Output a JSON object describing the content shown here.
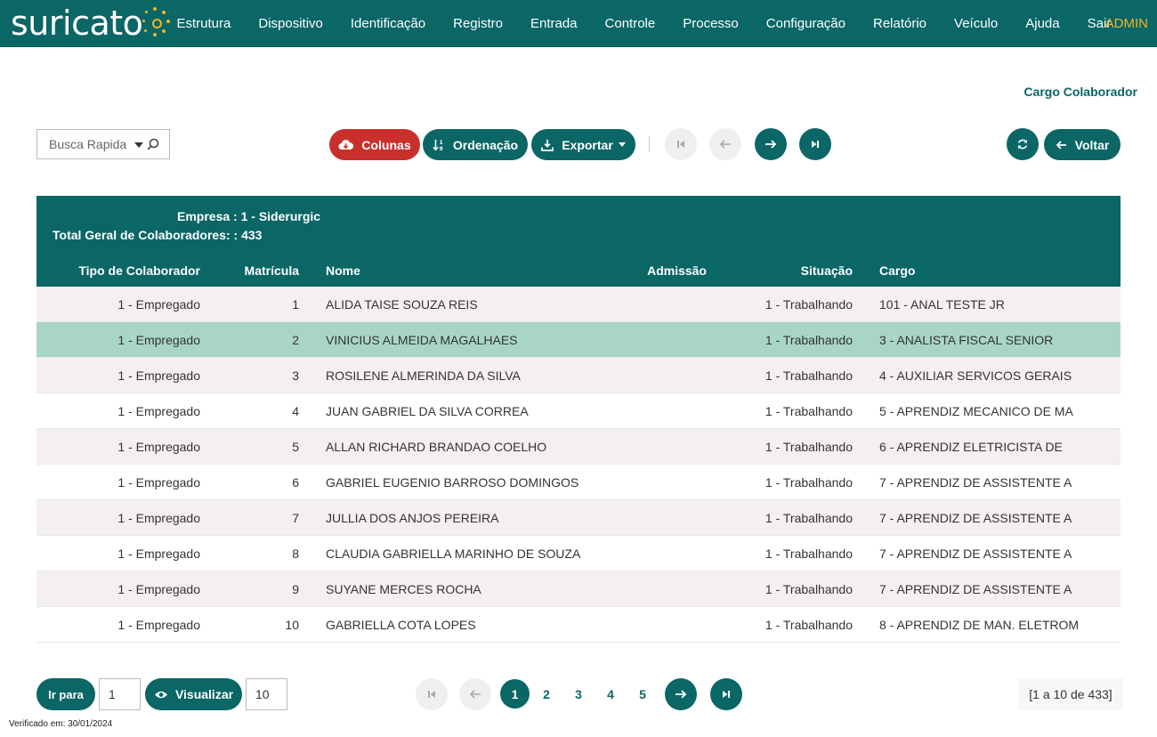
{
  "brand": {
    "logo_text": "suricato",
    "accent": "#f0b429",
    "primary": "#0b6666",
    "danger": "#c9302c"
  },
  "menu": {
    "items": [
      "Estrutura",
      "Dispositivo",
      "Identificação",
      "Registro",
      "Entrada",
      "Controle",
      "Processo",
      "Configuração",
      "Relatório",
      "Veículo",
      "Ajuda",
      "Sair"
    ],
    "user": "ADMIN"
  },
  "page": {
    "title": "Cargo Colaborador"
  },
  "search": {
    "placeholder": "Busca Rapida"
  },
  "toolbar": {
    "columns_label": "Colunas",
    "sort_label": "Ordenação",
    "export_label": "Exportar",
    "back_label": "Voltar"
  },
  "report": {
    "company_line": "Empresa : 1 - Siderurgic",
    "total_line": "Total Geral de Colaboradores: : 433"
  },
  "table": {
    "columns": [
      "Tipo de Colaborador",
      "Matrícula",
      "Nome",
      "Admissão",
      "Situação",
      "Cargo"
    ],
    "rows": [
      {
        "tipo": "1 - Empregado",
        "matricula": "1",
        "nome": "ALIDA TAISE SOUZA REIS",
        "admissao": "",
        "situacao": "1 - Trabalhando",
        "cargo": "101 - ANAL TESTE JR"
      },
      {
        "tipo": "1 - Empregado",
        "matricula": "2",
        "nome": "VINICIUS ALMEIDA MAGALHAES",
        "admissao": "",
        "situacao": "1 - Trabalhando",
        "cargo": "3 - ANALISTA FISCAL SENIOR"
      },
      {
        "tipo": "1 - Empregado",
        "matricula": "3",
        "nome": "ROSILENE ALMERINDA DA SILVA",
        "admissao": "",
        "situacao": "1 - Trabalhando",
        "cargo": "4 - AUXILIAR SERVICOS GERAIS"
      },
      {
        "tipo": "1 - Empregado",
        "matricula": "4",
        "nome": "JUAN GABRIEL DA SILVA CORREA",
        "admissao": "",
        "situacao": "1 - Trabalhando",
        "cargo": "5 - APRENDIZ MECANICO DE MA"
      },
      {
        "tipo": "1 - Empregado",
        "matricula": "5",
        "nome": "ALLAN RICHARD BRANDAO COELHO",
        "admissao": "",
        "situacao": "1 - Trabalhando",
        "cargo": "6 - APRENDIZ ELETRICISTA DE"
      },
      {
        "tipo": "1 - Empregado",
        "matricula": "6",
        "nome": "GABRIEL EUGENIO BARROSO DOMINGOS",
        "admissao": "",
        "situacao": "1 - Trabalhando",
        "cargo": "7 - APRENDIZ DE ASSISTENTE A"
      },
      {
        "tipo": "1 - Empregado",
        "matricula": "7",
        "nome": "JULLIA DOS ANJOS PEREIRA",
        "admissao": "",
        "situacao": "1 - Trabalhando",
        "cargo": "7 - APRENDIZ DE ASSISTENTE A"
      },
      {
        "tipo": "1 - Empregado",
        "matricula": "8",
        "nome": "CLAUDIA GABRIELLA MARINHO DE SOUZA",
        "admissao": "",
        "situacao": "1 - Trabalhando",
        "cargo": "7 - APRENDIZ DE ASSISTENTE A"
      },
      {
        "tipo": "1 - Empregado",
        "matricula": "9",
        "nome": "SUYANE MERCES ROCHA",
        "admissao": "",
        "situacao": "1 - Trabalhando",
        "cargo": "7 - APRENDIZ DE ASSISTENTE A"
      },
      {
        "tipo": "1 - Empregado",
        "matricula": "10",
        "nome": "GABRIELLA COTA LOPES",
        "admissao": "",
        "situacao": "1 - Trabalhando",
        "cargo": "8 - APRENDIZ DE MAN. ELETROM"
      }
    ],
    "selected_row": 1
  },
  "footer": {
    "goto_label": "Ir para",
    "goto_value": "1",
    "view_label": "Visualizar",
    "view_value": "10",
    "pages": [
      "1",
      "2",
      "3",
      "4",
      "5"
    ],
    "current_page": "1",
    "range_text": "[1 a 10 de 433]",
    "verified_text": "Verificado em: 30/01/2024"
  }
}
